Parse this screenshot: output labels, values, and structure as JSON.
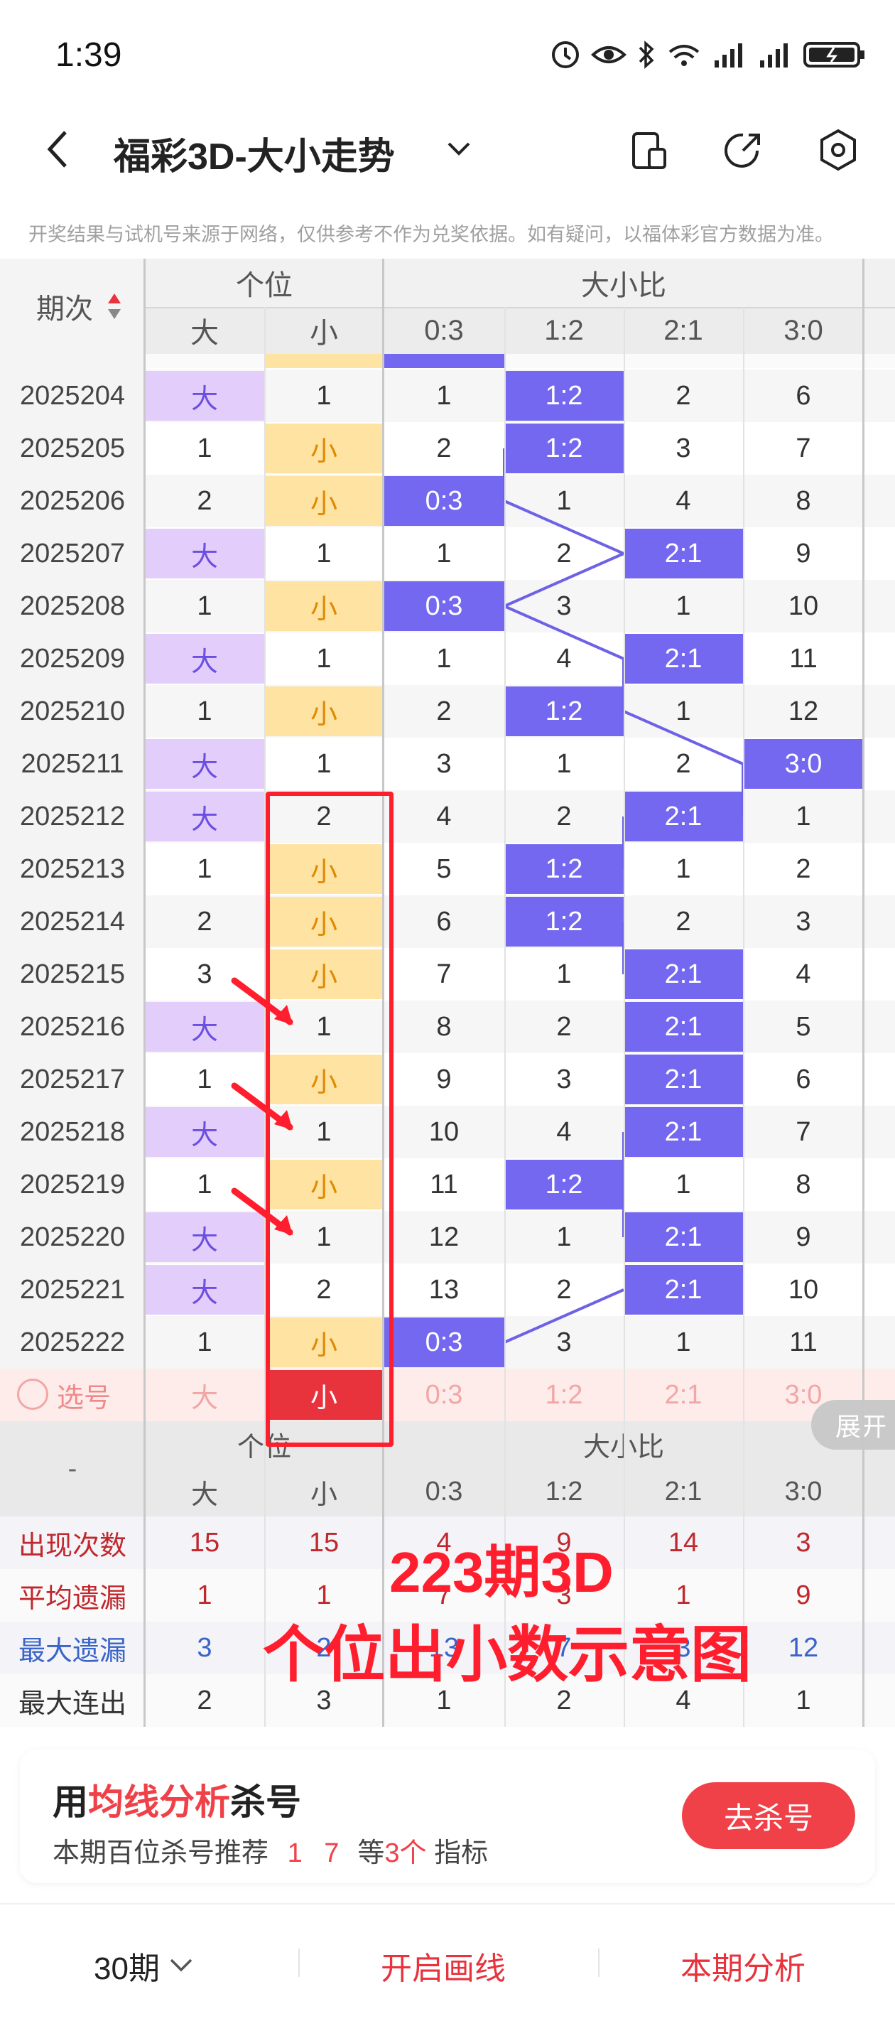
{
  "status": {
    "time": "1:39"
  },
  "header": {
    "title": "福彩3D-大小走势"
  },
  "notice": "开奖结果与试机号来源于网络，仅供参考不作为兑奖依据。如有疑问，以福体彩官方数据为准。",
  "table": {
    "period_header": "期次",
    "group1": "个位",
    "group2": "大小比",
    "subheaders": [
      "大",
      "小",
      "0:3",
      "1:2",
      "2:1",
      "3:0"
    ],
    "rows": [
      {
        "period": "2025204",
        "big": "大",
        "small": "1",
        "r03": "1",
        "r12": "1:2",
        "r21": "2",
        "r30": "6",
        "hit": "big",
        "ratio": "r12"
      },
      {
        "period": "2025205",
        "big": "1",
        "small": "小",
        "r03": "2",
        "r12": "1:2",
        "r21": "3",
        "r30": "7",
        "hit": "small",
        "ratio": "r12"
      },
      {
        "period": "2025206",
        "big": "2",
        "small": "小",
        "r03": "0:3",
        "r12": "1",
        "r21": "4",
        "r30": "8",
        "hit": "small",
        "ratio": "r03"
      },
      {
        "period": "2025207",
        "big": "大",
        "small": "1",
        "r03": "1",
        "r12": "2",
        "r21": "2:1",
        "r30": "9",
        "hit": "big",
        "ratio": "r21"
      },
      {
        "period": "2025208",
        "big": "1",
        "small": "小",
        "r03": "0:3",
        "r12": "3",
        "r21": "1",
        "r30": "10",
        "hit": "small",
        "ratio": "r03"
      },
      {
        "period": "2025209",
        "big": "大",
        "small": "1",
        "r03": "1",
        "r12": "4",
        "r21": "2:1",
        "r30": "11",
        "hit": "big",
        "ratio": "r21"
      },
      {
        "period": "2025210",
        "big": "1",
        "small": "小",
        "r03": "2",
        "r12": "1:2",
        "r21": "1",
        "r30": "12",
        "hit": "small",
        "ratio": "r12"
      },
      {
        "period": "2025211",
        "big": "大",
        "small": "1",
        "r03": "3",
        "r12": "1",
        "r21": "2",
        "r30": "3:0",
        "hit": "big",
        "ratio": "r30"
      },
      {
        "period": "2025212",
        "big": "大",
        "small": "2",
        "r03": "4",
        "r12": "2",
        "r21": "2:1",
        "r30": "1",
        "hit": "big",
        "ratio": "r21"
      },
      {
        "period": "2025213",
        "big": "1",
        "small": "小",
        "r03": "5",
        "r12": "1:2",
        "r21": "1",
        "r30": "2",
        "hit": "small",
        "ratio": "r12"
      },
      {
        "period": "2025214",
        "big": "2",
        "small": "小",
        "r03": "6",
        "r12": "1:2",
        "r21": "2",
        "r30": "3",
        "hit": "small",
        "ratio": "r12"
      },
      {
        "period": "2025215",
        "big": "3",
        "small": "小",
        "r03": "7",
        "r12": "1",
        "r21": "2:1",
        "r30": "4",
        "hit": "small",
        "ratio": "r21"
      },
      {
        "period": "2025216",
        "big": "大",
        "small": "1",
        "r03": "8",
        "r12": "2",
        "r21": "2:1",
        "r30": "5",
        "hit": "big",
        "ratio": "r21"
      },
      {
        "period": "2025217",
        "big": "1",
        "small": "小",
        "r03": "9",
        "r12": "3",
        "r21": "2:1",
        "r30": "6",
        "hit": "small",
        "ratio": "r21"
      },
      {
        "period": "2025218",
        "big": "大",
        "small": "1",
        "r03": "10",
        "r12": "4",
        "r21": "2:1",
        "r30": "7",
        "hit": "big",
        "ratio": "r21"
      },
      {
        "period": "2025219",
        "big": "1",
        "small": "小",
        "r03": "11",
        "r12": "1:2",
        "r21": "1",
        "r30": "8",
        "hit": "small",
        "ratio": "r12"
      },
      {
        "period": "2025220",
        "big": "大",
        "small": "1",
        "r03": "12",
        "r12": "1",
        "r21": "2:1",
        "r30": "9",
        "hit": "big",
        "ratio": "r21"
      },
      {
        "period": "2025221",
        "big": "大",
        "small": "2",
        "r03": "13",
        "r12": "2",
        "r21": "2:1",
        "r30": "10",
        "hit": "big",
        "ratio": "r21"
      },
      {
        "period": "2025222",
        "big": "1",
        "small": "小",
        "r03": "0:3",
        "r12": "3",
        "r21": "1",
        "r30": "11",
        "hit": "small",
        "ratio": "r03"
      }
    ],
    "select_row": {
      "label": "选号",
      "big": "大",
      "small": "小",
      "r03": "0:3",
      "r12": "1:2",
      "r21": "2:1",
      "r30": "3:0"
    },
    "footer_period": "-",
    "expand_label": "展开",
    "stats": [
      {
        "label": "出现次数",
        "values": [
          "15",
          "15",
          "4",
          "9",
          "14",
          "3"
        ],
        "color": "#c0282d"
      },
      {
        "label": "平均遗漏",
        "values": [
          "1",
          "1",
          "7",
          "3",
          "1",
          "9"
        ],
        "color": "#c0282d"
      },
      {
        "label": "最大遗漏",
        "values": [
          "3",
          "2",
          "13",
          "7",
          "3",
          "12"
        ],
        "color": "#3a64c8"
      },
      {
        "label": "最大连出",
        "values": [
          "2",
          "3",
          "1",
          "2",
          "4",
          "1"
        ],
        "color": "#333"
      }
    ]
  },
  "overlay": {
    "line1": "223期3D",
    "line2": "个位出小数示意图"
  },
  "promo": {
    "title_pre": "用",
    "title_highlight": "均线分析",
    "title_post": "杀号",
    "sub_pre": "本期百位杀号推荐",
    "sub_nums": "1 7",
    "sub_mid": "等",
    "sub_count": "3个",
    "sub_post": "指标",
    "button": "去杀号"
  },
  "bottom": {
    "periods": "30期",
    "draw_line": "开启画线",
    "analysis": "本期分析"
  },
  "colors": {
    "accent_red": "#f04048",
    "big_bg": "#e3cdfa",
    "small_bg": "#fee3a3",
    "ratio_bg": "#7568f0"
  }
}
